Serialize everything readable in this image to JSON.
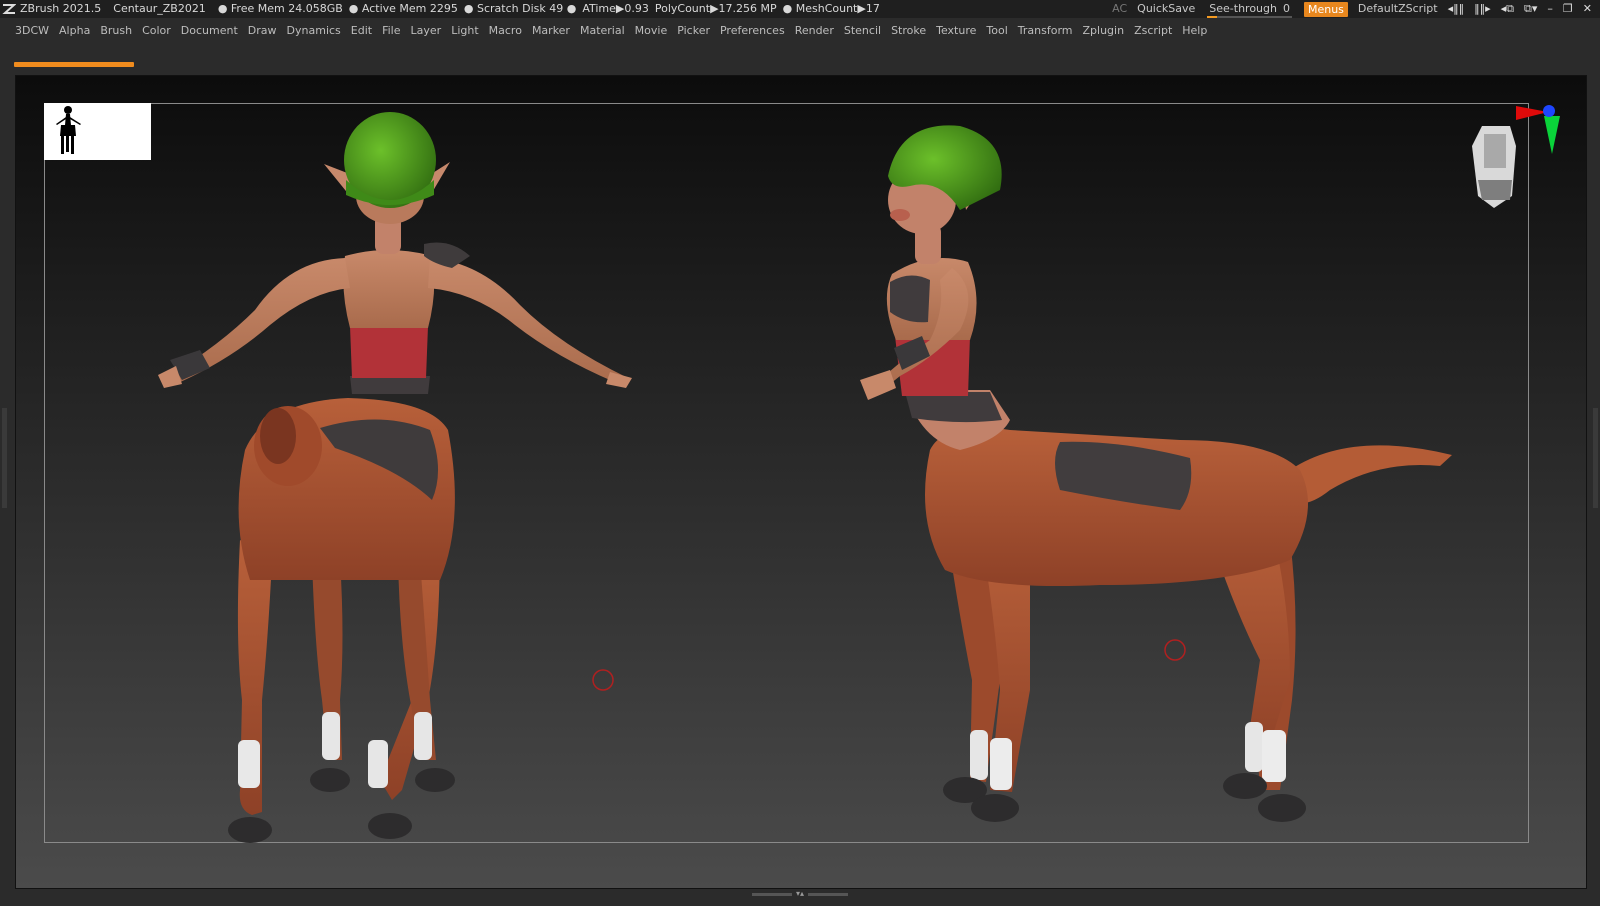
{
  "titlebar": {
    "app_name": "ZBrush 2021.5",
    "document_name": "Centaur_ZB2021",
    "free_mem": "● Free Mem 24.058GB",
    "active_mem": "● Active Mem 2295",
    "scratch_disk": "● Scratch Disk 49 ●",
    "atime": "ATime▶0.93",
    "polycount": "PolyCount▶17.256 MP",
    "meshcount": "● MeshCount▶17",
    "ac": "AC",
    "quicksave": "QuickSave",
    "see_through_label": "See-through",
    "see_through_value": "0",
    "menus": "Menus",
    "default_zscript": "DefaultZScript"
  },
  "menubar": {
    "items": [
      "3DCW",
      "Alpha",
      "Brush",
      "Color",
      "Document",
      "Draw",
      "Dynamics",
      "Edit",
      "File",
      "Layer",
      "Light",
      "Macro",
      "Marker",
      "Material",
      "Movie",
      "Picker",
      "Preferences",
      "Render",
      "Stencil",
      "Stroke",
      "Texture",
      "Tool",
      "Transform",
      "Zplugin",
      "Zscript",
      "Help"
    ]
  },
  "colors": {
    "accent": "#f08c1e",
    "skin": "#b97a55",
    "horse": "#a85432",
    "hair": "#4f9a1f",
    "corset": "#b23238",
    "leather": "#3e3b3c"
  }
}
